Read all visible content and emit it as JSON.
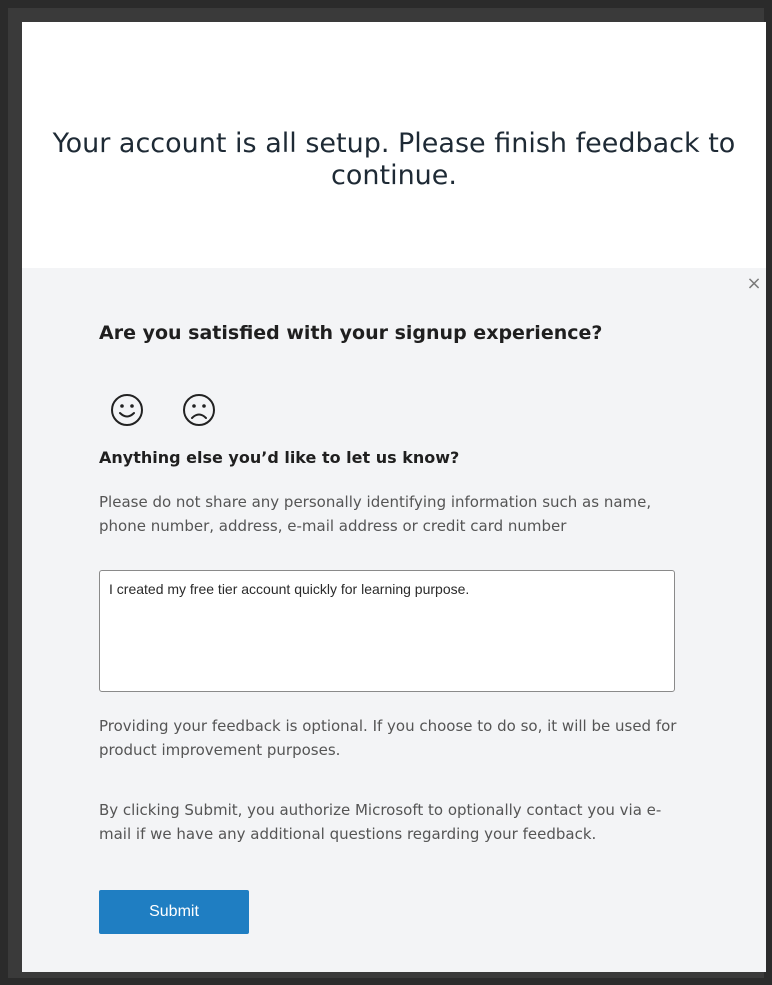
{
  "banner": {
    "title": "Your account is all setup. Please finish feedback to continue."
  },
  "feedback": {
    "close_symbol": "×",
    "question_satisfied": "Are you satisfied with your signup experience?",
    "icons": {
      "happy": "smiley-face-icon",
      "sad": "sad-face-icon"
    },
    "question_else": "Anything else you’d like to let us know?",
    "privacy_note": "Please do not share any personally identifying information such as name, phone number, address, e-mail address or credit card number",
    "input_value": "I created my free tier account quickly for learning purpose.",
    "optional_note": "Providing your feedback is optional. If you choose to do so, it will be used for product improvement purposes.",
    "authorize_note": "By clicking Submit, you authorize Microsoft to optionally contact you via e-mail if we have any additional questions regarding your feedback.",
    "submit_label": "Submit"
  },
  "colors": {
    "accent": "#1f7ec2",
    "panel_bg": "#f3f4f6",
    "banner_bg": "#ffffff"
  }
}
